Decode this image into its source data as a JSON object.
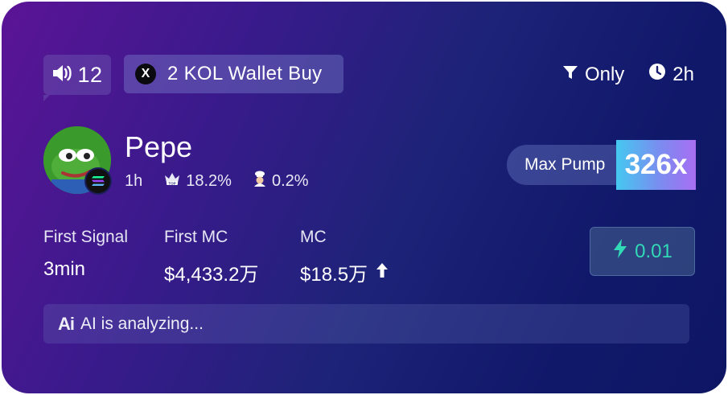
{
  "card": {
    "sound_count": "12",
    "kol_badge": "2 KOL Wallet Buy",
    "x_logo": "X",
    "filter_label": "Only",
    "time_label": "2h"
  },
  "token": {
    "name": "Pepe",
    "age": "1h",
    "top_holders_pct": "18.2%",
    "dev_pct": "0.2%",
    "max_pump_label": "Max Pump",
    "max_pump_value": "326x"
  },
  "stats": {
    "first_signal_label": "First Signal",
    "first_signal_value": "3min",
    "first_mc_label": "First MC",
    "first_mc_value": "$4,433.2万",
    "mc_label": "MC",
    "mc_value": "$18.5万"
  },
  "buy_button": {
    "amount": "0.01"
  },
  "ai": {
    "icon_text": "Ai",
    "status": "AI is analyzing..."
  },
  "icons": [
    "speaker-icon",
    "x-logo-icon",
    "filter-icon",
    "clock-icon",
    "top-crown-icon",
    "chef-icon",
    "arrow-up-icon",
    "lightning-icon",
    "ai-icon",
    "solana-icon"
  ],
  "colors": {
    "buy_accent": "#31d9b6",
    "pump_gradient_start": "#45c8f0",
    "pump_gradient_end": "#a86ef2"
  }
}
